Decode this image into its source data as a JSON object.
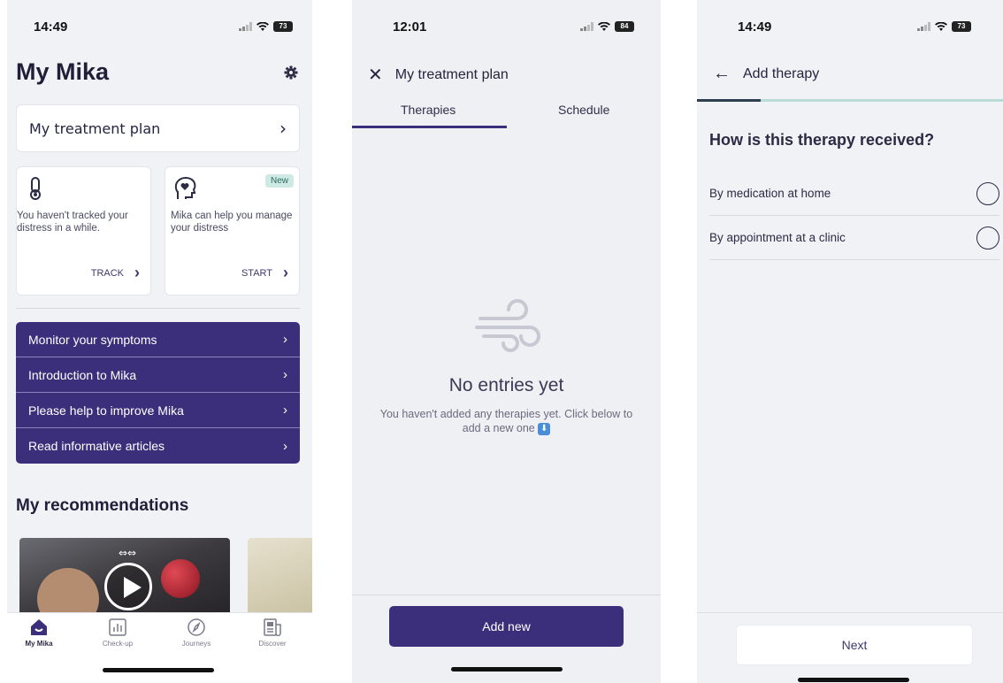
{
  "screen1": {
    "status": {
      "time": "14:49",
      "battery": "73"
    },
    "title": "My Mika",
    "treatment_plan": "My treatment plan",
    "track_card": {
      "text": "You haven't tracked your distress in a while.",
      "action": "TRACK"
    },
    "help_card": {
      "badge": "New",
      "text": "Mika can help you manage your distress",
      "action": "START"
    },
    "menu": [
      {
        "label": "Monitor your symptoms"
      },
      {
        "label": "Introduction to Mika"
      },
      {
        "label": "Please help to improve Mika"
      },
      {
        "label": "Read informative articles"
      }
    ],
    "recommendations_title": "My recommendations",
    "tabs": [
      {
        "label": "My Mika"
      },
      {
        "label": "Check-up"
      },
      {
        "label": "Journeys"
      },
      {
        "label": "Discover"
      }
    ]
  },
  "screen2": {
    "status": {
      "time": "12:01",
      "battery": "84"
    },
    "title": "My treatment plan",
    "tabs": [
      {
        "label": "Therapies"
      },
      {
        "label": "Schedule"
      }
    ],
    "empty_title": "No entries yet",
    "empty_text": "You haven't added any therapies yet. Click below to add a new one",
    "add_button": "Add new"
  },
  "screen3": {
    "status": {
      "time": "14:49",
      "battery": "73"
    },
    "title": "Add therapy",
    "question": "How is this therapy received?",
    "options": [
      {
        "label": "By medication at home"
      },
      {
        "label": "By appointment at a clinic"
      }
    ],
    "next_button": "Next"
  },
  "colors": {
    "primary": "#3b2f7c",
    "background": "#f1f2f6",
    "accent_teal": "#b9dcd6"
  }
}
